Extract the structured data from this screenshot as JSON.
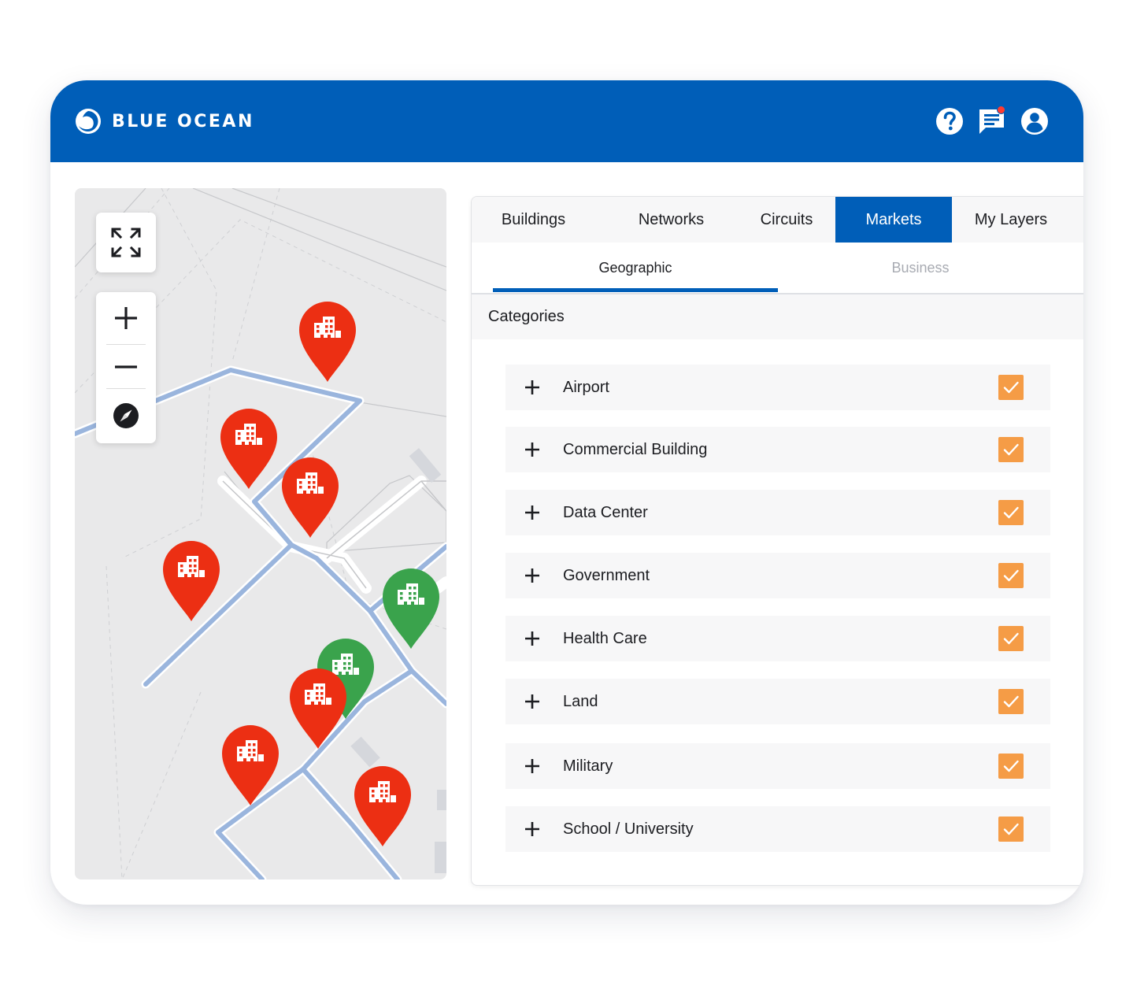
{
  "header": {
    "brand_name": "BLUE OCEAN",
    "brand_color": "#005eb8",
    "icons": [
      "help-icon",
      "chat-icon",
      "account-icon"
    ],
    "has_notification": true
  },
  "map": {
    "controls": [
      "fullscreen-icon",
      "zoom-in-icon",
      "zoom-out-icon",
      "compass-icon"
    ],
    "markers": [
      {
        "color": "#ec2f13",
        "icon": "building-icon"
      },
      {
        "color": "#ec2f13",
        "icon": "building-icon"
      },
      {
        "color": "#ec2f13",
        "icon": "building-icon"
      },
      {
        "color": "#ec2f13",
        "icon": "building-icon"
      },
      {
        "color": "#3aa34c",
        "icon": "building-icon"
      },
      {
        "color": "#3aa34c",
        "icon": "building-icon"
      },
      {
        "color": "#ec2f13",
        "icon": "building-icon"
      },
      {
        "color": "#ec2f13",
        "icon": "building-icon"
      },
      {
        "color": "#ec2f13",
        "icon": "building-icon"
      }
    ]
  },
  "panel": {
    "tabs": [
      {
        "label": "Buildings",
        "active": false
      },
      {
        "label": "Networks",
        "active": false
      },
      {
        "label": "Circuits",
        "active": false
      },
      {
        "label": "Markets",
        "active": true
      },
      {
        "label": "My Layers",
        "active": false
      }
    ],
    "subtabs": [
      {
        "label": "Geographic",
        "active": true
      },
      {
        "label": "Business",
        "active": false
      }
    ],
    "categories_title": "Categories",
    "categories": [
      {
        "label": "Airport",
        "checked": true
      },
      {
        "label": "Commercial Building",
        "checked": true
      },
      {
        "label": "Data Center",
        "checked": true
      },
      {
        "label": "Government",
        "checked": true
      },
      {
        "label": "Health Care",
        "checked": true
      },
      {
        "label": "Land",
        "checked": true
      },
      {
        "label": "Military",
        "checked": true
      },
      {
        "label": "School / University",
        "checked": true
      }
    ],
    "checkbox_color": "#f59c46"
  }
}
